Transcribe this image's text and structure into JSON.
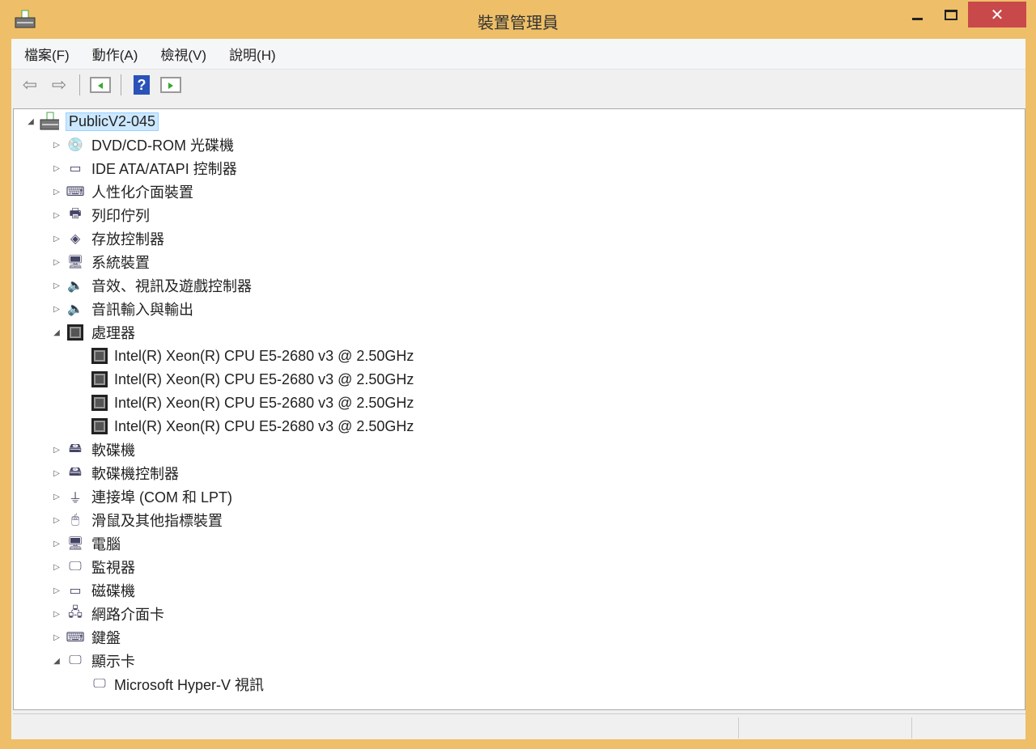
{
  "window": {
    "title": "裝置管理員",
    "close_glyph": "✕"
  },
  "menu": [
    "檔案(F)",
    "動作(A)",
    "檢視(V)",
    "說明(H)"
  ],
  "toolbar": {
    "back": "⇦",
    "forward": "⇨",
    "help": "?"
  },
  "tree": {
    "root": "PublicV2-045",
    "categories": [
      {
        "label": "DVD/CD-ROM 光碟機",
        "icon": "disc-drive-icon",
        "glyph": "💿",
        "expanded": false
      },
      {
        "label": "IDE ATA/ATAPI 控制器",
        "icon": "ide-controller-icon",
        "glyph": "▭",
        "expanded": false
      },
      {
        "label": "人性化介面裝置",
        "icon": "hid-icon",
        "glyph": "⌨",
        "expanded": false
      },
      {
        "label": "列印佇列",
        "icon": "printer-icon",
        "glyph": "🖶",
        "expanded": false
      },
      {
        "label": "存放控制器",
        "icon": "storage-controller-icon",
        "glyph": "◈",
        "expanded": false
      },
      {
        "label": "系統裝置",
        "icon": "system-device-icon",
        "glyph": "🖥",
        "expanded": false
      },
      {
        "label": "音效、視訊及遊戲控制器",
        "icon": "speaker-icon",
        "glyph": "🔈",
        "expanded": false
      },
      {
        "label": "音訊輸入與輸出",
        "icon": "speaker-icon",
        "glyph": "🔈",
        "expanded": false
      },
      {
        "label": "處理器",
        "icon": "processor-icon",
        "glyph": "",
        "expanded": true,
        "children": [
          "Intel(R) Xeon(R) CPU E5-2680 v3 @ 2.50GHz",
          "Intel(R) Xeon(R) CPU E5-2680 v3 @ 2.50GHz",
          "Intel(R) Xeon(R) CPU E5-2680 v3 @ 2.50GHz",
          "Intel(R) Xeon(R) CPU E5-2680 v3 @ 2.50GHz"
        ]
      },
      {
        "label": "軟碟機",
        "icon": "floppy-drive-icon",
        "glyph": "🖴",
        "expanded": false
      },
      {
        "label": "軟碟機控制器",
        "icon": "floppy-controller-icon",
        "glyph": "🖴",
        "expanded": false
      },
      {
        "label": "連接埠 (COM 和 LPT)",
        "icon": "port-icon",
        "glyph": "⏚",
        "expanded": false
      },
      {
        "label": "滑鼠及其他指標裝置",
        "icon": "mouse-icon",
        "glyph": "🖱",
        "expanded": false
      },
      {
        "label": "電腦",
        "icon": "computer-icon",
        "glyph": "🖥",
        "expanded": false
      },
      {
        "label": "監視器",
        "icon": "monitor-icon",
        "glyph": "🖵",
        "expanded": false
      },
      {
        "label": "磁碟機",
        "icon": "disk-drive-icon",
        "glyph": "▭",
        "expanded": false
      },
      {
        "label": "網路介面卡",
        "icon": "network-adapter-icon",
        "glyph": "🖧",
        "expanded": false
      },
      {
        "label": "鍵盤",
        "icon": "keyboard-icon",
        "glyph": "⌨",
        "expanded": false
      },
      {
        "label": "顯示卡",
        "icon": "display-adapter-icon",
        "glyph": "🖵",
        "expanded": true,
        "children": [
          "Microsoft Hyper-V 視訊"
        ]
      }
    ]
  }
}
